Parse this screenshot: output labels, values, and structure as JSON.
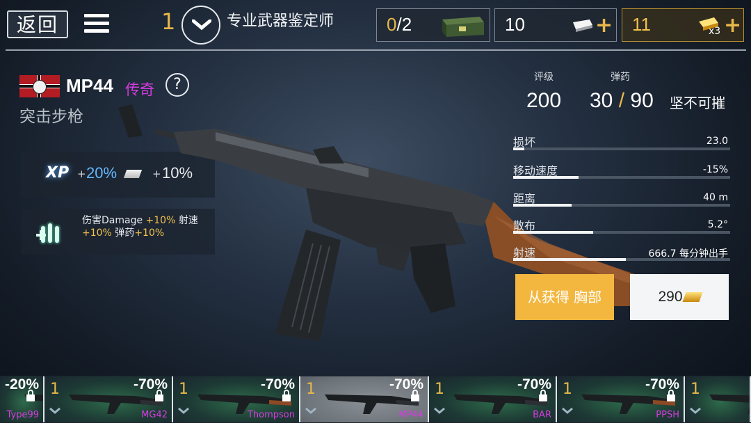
{
  "header": {
    "back_label": "返回",
    "rank_level": "1",
    "rank_title": "专业武器鉴定师",
    "crates": {
      "current": "0",
      "sep": "/2"
    },
    "silver": "10",
    "gold": "11",
    "gold_multiplier": "x3"
  },
  "weapon": {
    "name": "MP44",
    "rarity": "传奇",
    "class": "突击步枪",
    "xp_label": "XP",
    "xp_bonus": "20%",
    "silver_bonus": "10%",
    "bonus_line1_a": "伤害Damage ",
    "bonus_line1_b": "+10%",
    "bonus_line1_c": " 射速",
    "bonus_line2_a": "+10%",
    "bonus_line2_b": " 弹药",
    "bonus_line2_c": "+10%"
  },
  "stats": {
    "rating_label": "评级",
    "ammo_label": "弹药",
    "rating": "200",
    "ammo_mag": "30",
    "ammo_slash": "/",
    "ammo_total": "90",
    "durability": "坚不可摧",
    "rows": [
      {
        "label": "损坏",
        "value": "23.0",
        "fill": 0.05
      },
      {
        "label": "移动速度",
        "value": "-15%",
        "fill": 0.3
      },
      {
        "label": "距离",
        "value": "40 m",
        "fill": 0.27
      },
      {
        "label": "散布",
        "value": "5.2°",
        "fill": 0.37
      },
      {
        "label": "射速",
        "value": "666.7 每分钟出手",
        "fill": 0.52
      }
    ]
  },
  "actions": {
    "get_from": "从获得 胸部",
    "price": "290"
  },
  "weapon_strip": [
    {
      "level": "",
      "discount": "-20%",
      "name": "Type99",
      "selected": false
    },
    {
      "level": "1",
      "discount": "-70%",
      "name": "MG42",
      "selected": false
    },
    {
      "level": "1",
      "discount": "-70%",
      "name": "Thompson",
      "selected": false
    },
    {
      "level": "1",
      "discount": "-70%",
      "name": "MP44",
      "selected": true
    },
    {
      "level": "1",
      "discount": "-70%",
      "name": "BAR",
      "selected": false
    },
    {
      "level": "1",
      "discount": "-70%",
      "name": "PPSH",
      "selected": false
    },
    {
      "level": "1",
      "discount": "",
      "name": "",
      "selected": false
    }
  ],
  "colors": {
    "accent_gold": "#e8b84a",
    "rarity_purple": "#d63ce0",
    "xp_blue": "#63b8ff",
    "get_button": "#f3b740"
  }
}
